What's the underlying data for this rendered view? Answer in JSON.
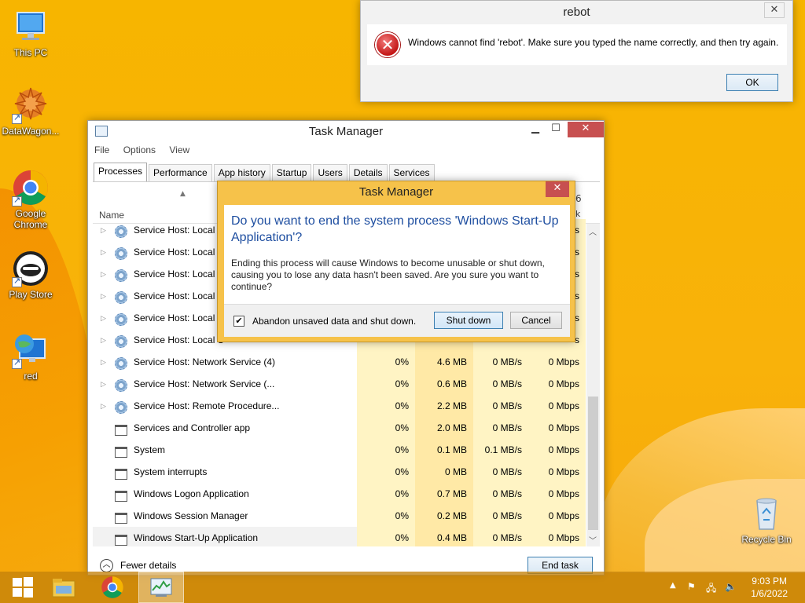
{
  "desktop": {
    "icons": [
      {
        "label": "This PC",
        "name": "this-pc"
      },
      {
        "label": "DataWagon...",
        "name": "datawagon"
      },
      {
        "label": "Google Chrome",
        "name": "google-chrome"
      },
      {
        "label": "Play Store",
        "name": "play-store"
      },
      {
        "label": "red",
        "name": "red"
      },
      {
        "label": "Recycle Bin",
        "name": "recycle-bin"
      }
    ]
  },
  "rebot_dialog": {
    "title": "rebot",
    "message": "Windows cannot find 'rebot'. Make sure you typed the name correctly, and then try again.",
    "ok_label": "OK",
    "close_glyph": "✕"
  },
  "task_manager": {
    "title": "Task Manager",
    "menu": [
      "File",
      "Options",
      "View"
    ],
    "tabs": [
      "Processes",
      "Performance",
      "App history",
      "Startup",
      "Users",
      "Details",
      "Services"
    ],
    "column_name": "Name",
    "sort_glyph": "▲",
    "header_fragment_top": "6",
    "header_fragment_bottom": "k",
    "rows": [
      {
        "expand": true,
        "icon": "gear",
        "name": "Service Host: Local S",
        "cpu": "",
        "mem": "",
        "disk": "",
        "net": "s"
      },
      {
        "expand": true,
        "icon": "gear",
        "name": "Service Host: Local S",
        "cpu": "",
        "mem": "",
        "disk": "",
        "net": "s"
      },
      {
        "expand": true,
        "icon": "gear",
        "name": "Service Host: Local S",
        "cpu": "",
        "mem": "",
        "disk": "",
        "net": "s"
      },
      {
        "expand": true,
        "icon": "gear",
        "name": "Service Host: Local S",
        "cpu": "",
        "mem": "",
        "disk": "",
        "net": "s"
      },
      {
        "expand": true,
        "icon": "gear",
        "name": "Service Host: Local S",
        "cpu": "",
        "mem": "",
        "disk": "",
        "net": "s"
      },
      {
        "expand": true,
        "icon": "gear",
        "name": "Service Host: Local S",
        "cpu": "",
        "mem": "",
        "disk": "",
        "net": "s"
      },
      {
        "expand": true,
        "icon": "gear",
        "name": "Service Host: Network Service (4)",
        "cpu": "0%",
        "mem": "4.6 MB",
        "disk": "0 MB/s",
        "net": "0 Mbps"
      },
      {
        "expand": true,
        "icon": "gear",
        "name": "Service Host: Network Service (...",
        "cpu": "0%",
        "mem": "0.6 MB",
        "disk": "0 MB/s",
        "net": "0 Mbps"
      },
      {
        "expand": true,
        "icon": "gear",
        "name": "Service Host: Remote Procedure...",
        "cpu": "0%",
        "mem": "2.2 MB",
        "disk": "0 MB/s",
        "net": "0 Mbps"
      },
      {
        "expand": false,
        "icon": "app",
        "name": "Services and Controller app",
        "cpu": "0%",
        "mem": "2.0 MB",
        "disk": "0 MB/s",
        "net": "0 Mbps"
      },
      {
        "expand": false,
        "icon": "app",
        "name": "System",
        "cpu": "0%",
        "mem": "0.1 MB",
        "disk": "0.1 MB/s",
        "net": "0 Mbps"
      },
      {
        "expand": false,
        "icon": "app",
        "name": "System interrupts",
        "cpu": "0%",
        "mem": "0 MB",
        "disk": "0 MB/s",
        "net": "0 Mbps"
      },
      {
        "expand": false,
        "icon": "app",
        "name": "Windows Logon Application",
        "cpu": "0%",
        "mem": "0.7 MB",
        "disk": "0 MB/s",
        "net": "0 Mbps"
      },
      {
        "expand": false,
        "icon": "app",
        "name": "Windows Session Manager",
        "cpu": "0%",
        "mem": "0.2 MB",
        "disk": "0 MB/s",
        "net": "0 Mbps"
      },
      {
        "expand": false,
        "icon": "app",
        "name": "Windows Start-Up Application",
        "cpu": "0%",
        "mem": "0.4 MB",
        "disk": "0 MB/s",
        "net": "0 Mbps",
        "selected": true
      }
    ],
    "fewer_details": "Fewer details",
    "end_task": "End task"
  },
  "confirm_dialog": {
    "title": "Task Manager",
    "question": "Do you want to end the system process 'Windows Start-Up Application'?",
    "message": "Ending this process will cause Windows to become unusable or shut down, causing you to lose any data hasn't been saved. Are you sure you want to continue?",
    "checkbox_label": "Abandon unsaved data and shut down.",
    "checkbox_checked": true,
    "shutdown_label": "Shut down",
    "cancel_label": "Cancel"
  },
  "taskbar": {
    "time": "9:03 PM",
    "date": "1/6/2022",
    "colors": {
      "taskbar": "#c4820a",
      "desktop": "#f7b500"
    }
  }
}
